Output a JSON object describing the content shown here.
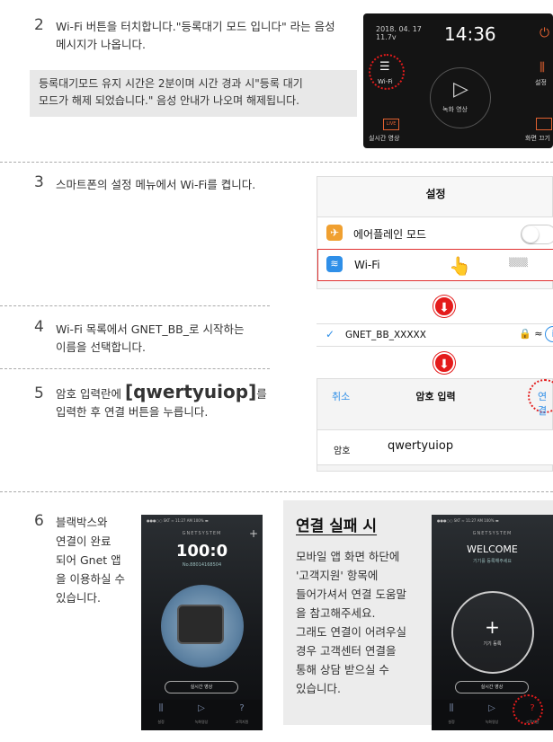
{
  "step2": {
    "num": "2",
    "line1": "Wi-Fi 버튼을 터치합니다.\"등록대기 모드 입니다\" 라는 음성",
    "line2": "메시지가 나옵니다.",
    "note_line1": "등록대기모드 유지 시간은 2분이며 시간 경과 시\"등록 대기",
    "note_line2": "모드가 해제 되었습니다.\"  음성 안내가 나오며 해제됩니다."
  },
  "device": {
    "date": "2018. 04. 17",
    "voltage": "11.7v",
    "time": "14:36",
    "wifi_label": "Wi-Fi",
    "record_label": "녹화 영상",
    "settings_label": "설정",
    "live_icon_text": "LIVE",
    "live_label": "실시간 영상",
    "screen_label": "화면 끄기",
    "icons": [
      "power-icon",
      "wifi-icon",
      "play-icon",
      "settings-sliders-icon",
      "live-icon",
      "screen-off-icon"
    ]
  },
  "step3": {
    "num": "3",
    "text": "스마트폰의 설정 메뉴에서 Wi-Fi를 켭니다."
  },
  "ios_settings": {
    "title": "설정",
    "airplane_label": "에어플레인 모드",
    "wifi_label": "Wi-Fi",
    "wifi_value": "▒▒▒",
    "icons": [
      "airplane-icon",
      "wifi-icon",
      "pointing-hand-icon"
    ]
  },
  "step4": {
    "num": "4",
    "line1": "Wi-Fi 목록에서 GNET_BB_로 시작하는",
    "line2": "이름을 선택합니다."
  },
  "network": {
    "name": "GNET_BB_XXXXX",
    "icons_text": "🔒 ≈",
    "info": "i"
  },
  "step5": {
    "num": "5",
    "pre": "암호 입력란에 ",
    "password": "[qwertyuiop]",
    "post": "를",
    "line2": "입력한 후 연결 버튼을 누릅니다."
  },
  "password_screen": {
    "cancel": "취소",
    "title": "암호 입력",
    "connect": "연결",
    "label": "암호",
    "value": "qwertyuiop"
  },
  "step6": {
    "num": "6",
    "lines": [
      "블랙박스와",
      "연결이 완료",
      "되어 Gnet 앱",
      "을 이용하실 수",
      "있습니다."
    ]
  },
  "phone1": {
    "status": "●●●○○ SKT  ≈       11:27 AM        100% ▬",
    "brand": "GNETSYSTEM",
    "model": "100:0",
    "serial": "No.88014168504",
    "live_btn": "실시간 영상",
    "nav": [
      "설정",
      "녹화영상",
      "고객지원"
    ]
  },
  "fail": {
    "title": "연결 실패 시",
    "lines": [
      "모바일 앱 화면 하단에",
      "'고객지원' 항목에",
      "들어가셔서 연결 도움말",
      "을 참고해주세요.",
      "그래도 연결이 어려우실",
      "경우 고객센터 연결을",
      "통해 상담 받으실 수",
      "있습니다."
    ]
  },
  "phone2": {
    "status": "●●●○○ SKT  ≈       11:27 AM        100% ▬",
    "brand": "GNETSYSTEM",
    "welcome": "WELCOME",
    "sub": "기기를 등록해주세요",
    "add_label": "기기 등록",
    "live_btn": "실시간 영상",
    "nav": [
      "설정",
      "녹화영상",
      "고객지원"
    ]
  },
  "colors": {
    "accent_red": "#e41b1b",
    "ios_blue": "#2f8fe8",
    "device_orange": "#e06030"
  }
}
